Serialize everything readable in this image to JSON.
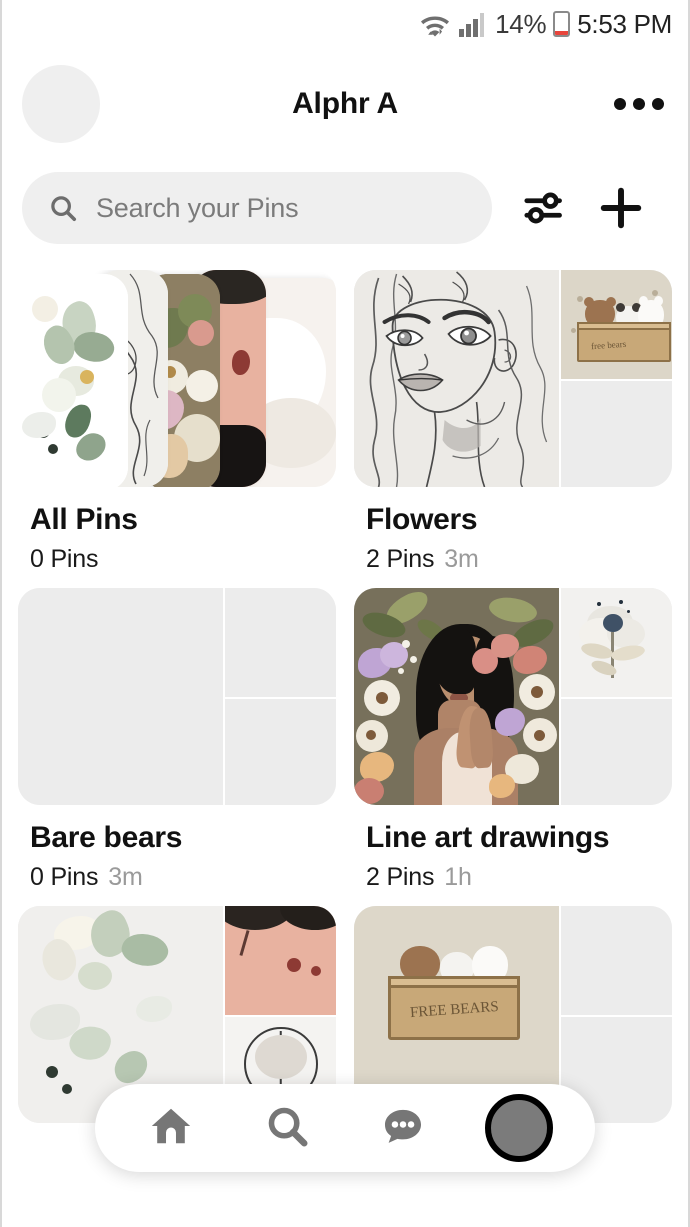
{
  "status_bar": {
    "wifi_icon": "wifi-icon",
    "signal_icon": "cellular-signal-icon",
    "battery_percent": "14%",
    "battery_icon": "battery-low-icon",
    "time": "5:53 PM"
  },
  "header": {
    "avatar": "profile-avatar",
    "title": "Alphr A",
    "more_icon": "more-options-icon"
  },
  "search": {
    "icon": "search-icon",
    "placeholder": "Search your Pins",
    "value": "",
    "filter_icon": "filter-sliders-icon",
    "add_icon": "plus-icon"
  },
  "boards": [
    {
      "name": "All Pins",
      "pins": "0 Pins",
      "time": "",
      "cover_type": "fan"
    },
    {
      "name": "Flowers",
      "pins": "2 Pins",
      "time": "3m",
      "cover_type": "grid"
    },
    {
      "name": "Bare bears",
      "pins": "0 Pins",
      "time": "3m",
      "cover_type": "empty"
    },
    {
      "name": "Line art drawings",
      "pins": "2 Pins",
      "time": "1h",
      "cover_type": "grid"
    },
    {
      "name": "",
      "pins": "",
      "time": "",
      "cover_type": "grid"
    },
    {
      "name": "",
      "pins": "",
      "time": "",
      "cover_type": "grid"
    }
  ],
  "bottom_nav": {
    "items": [
      {
        "icon": "home-icon",
        "active": false
      },
      {
        "icon": "search-icon",
        "active": false
      },
      {
        "icon": "chat-bubble-icon",
        "active": false
      },
      {
        "icon": "profile-avatar-icon",
        "active": true
      }
    ]
  },
  "colors": {
    "background": "#ffffff",
    "text_primary": "#111111",
    "text_muted": "#9a9a9a",
    "chip_bg": "#efefef",
    "placeholder_tile": "#ececec",
    "battery_low": "#e8453c",
    "nav_icon": "#767676"
  }
}
